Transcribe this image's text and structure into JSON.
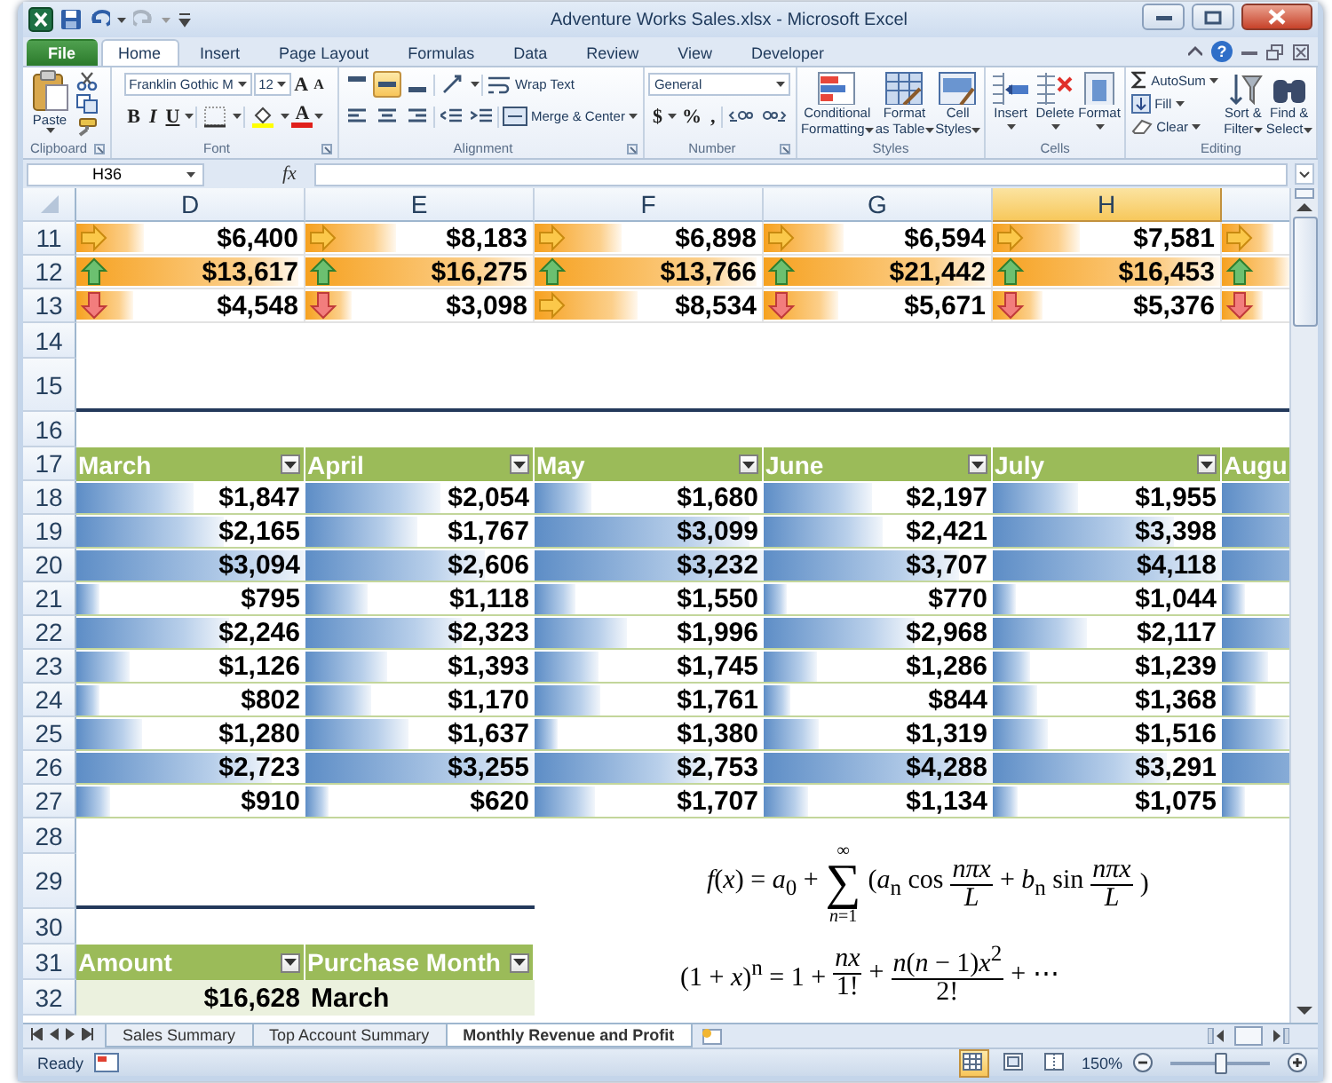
{
  "window": {
    "title": "Adventure Works Sales.xlsx - Microsoft Excel",
    "help": "?"
  },
  "ribbon_tabs": [
    {
      "label": "File",
      "kind": "file",
      "selected": false
    },
    {
      "label": "Home",
      "kind": "tab",
      "selected": true
    },
    {
      "label": "Insert",
      "kind": "tab",
      "selected": false
    },
    {
      "label": "Page Layout",
      "kind": "tab",
      "selected": false
    },
    {
      "label": "Formulas",
      "kind": "tab",
      "selected": false
    },
    {
      "label": "Data",
      "kind": "tab",
      "selected": false
    },
    {
      "label": "Review",
      "kind": "tab",
      "selected": false
    },
    {
      "label": "View",
      "kind": "tab",
      "selected": false
    },
    {
      "label": "Developer",
      "kind": "tab",
      "selected": false
    }
  ],
  "ribbon": {
    "clipboard": {
      "label": "Clipboard",
      "paste": "Paste"
    },
    "font": {
      "label": "Font",
      "name": "Franklin Gothic M",
      "size": "12",
      "grow": "A",
      "shrink": "A",
      "bold": "B",
      "italic": "I",
      "underline": "U",
      "color_letter": "A"
    },
    "alignment": {
      "label": "Alignment",
      "wrap": "Wrap Text",
      "merge": "Merge & Center",
      "vertical": [
        {
          "selected": false
        },
        {
          "selected": true
        },
        {
          "selected": false
        }
      ]
    },
    "number": {
      "label": "Number",
      "format": "General",
      "currency": "$",
      "percent": "%",
      "comma": ","
    },
    "styles": {
      "label": "Styles",
      "buttons": [
        "Conditional\nFormatting",
        "Format\nas Table",
        "Cell\nStyles"
      ]
    },
    "cells": {
      "label": "Cells",
      "buttons": [
        "Insert",
        "Delete",
        "Format"
      ]
    },
    "editing": {
      "label": "Editing",
      "autosum": "AutoSum",
      "fill": "Fill",
      "clear": "Clear",
      "sort": "Sort &\nFilter",
      "find": "Find &\nSelect"
    }
  },
  "formula_bar": {
    "name_box": "H36",
    "function": "fx"
  },
  "columns": [
    {
      "label": "D",
      "selected": false
    },
    {
      "label": "E",
      "selected": false
    },
    {
      "label": "F",
      "selected": false
    },
    {
      "label": "G",
      "selected": false
    },
    {
      "label": "H",
      "selected": true
    }
  ],
  "rows": [
    {
      "number": "11",
      "kind": "icon_bars",
      "cells": [
        {
          "kind": "flat",
          "level": 0.3,
          "value": "$6,400"
        },
        {
          "kind": "flat",
          "level": 0.4,
          "value": "$8,183"
        },
        {
          "kind": "flat",
          "level": 0.38,
          "value": "$6,898"
        },
        {
          "kind": "flat",
          "level": 0.35,
          "value": "$6,594"
        },
        {
          "kind": "flat",
          "level": 0.38,
          "value": "$7,581"
        },
        {
          "kind": "flat",
          "level": 0.23
        }
      ]
    },
    {
      "number": "12",
      "kind": "icon_bars",
      "cells": [
        {
          "kind": "up",
          "level": 0.98,
          "value": "$13,617"
        },
        {
          "kind": "up",
          "level": 1,
          "value": "$16,275"
        },
        {
          "kind": "up",
          "level": 0.98,
          "value": "$13,766"
        },
        {
          "kind": "up",
          "level": 1,
          "value": "$21,442"
        },
        {
          "kind": "up",
          "level": 1,
          "value": "$16,453"
        },
        {
          "kind": "up",
          "level": 0.3
        }
      ]
    },
    {
      "number": "13",
      "kind": "icon_bars",
      "cells": [
        {
          "kind": "down",
          "level": 0.25,
          "value": "$4,548"
        },
        {
          "kind": "down",
          "level": 0.2,
          "value": "$3,098"
        },
        {
          "kind": "flat",
          "level": 0.45,
          "value": "$8,534"
        },
        {
          "kind": "down",
          "level": 0.33,
          "value": "$5,671"
        },
        {
          "kind": "down",
          "level": 0.22,
          "value": "$5,376"
        },
        {
          "kind": "down",
          "level": 0.18
        }
      ]
    },
    {
      "number": "14",
      "kind": "gap"
    },
    {
      "number": "15",
      "kind": "section_end"
    },
    {
      "number": "16",
      "kind": "gap"
    },
    {
      "number": "17",
      "kind": "table_header",
      "cells": [
        "March",
        "April",
        "May",
        "June",
        "July",
        "Augu"
      ]
    },
    {
      "number": "18",
      "kind": "blue_bars",
      "cells": [
        {
          "level": 0.51,
          "value": "$1,847"
        },
        {
          "level": 0.59,
          "value": "$2,054"
        },
        {
          "level": 0.25,
          "value": "$1,680"
        },
        {
          "level": 0.47,
          "value": "$2,197"
        },
        {
          "level": 0.37,
          "value": "$1,955"
        },
        {
          "level": 0.6
        }
      ]
    },
    {
      "number": "19",
      "kind": "blue_bars",
      "cells": [
        {
          "level": 0.64,
          "value": "$2,165"
        },
        {
          "level": 0.49,
          "value": "$1,767"
        },
        {
          "level": 0.94,
          "value": "$3,099"
        },
        {
          "level": 0.52,
          "value": "$2,421"
        },
        {
          "level": 0.79,
          "value": "$3,398"
        },
        {
          "level": 0.7
        }
      ]
    },
    {
      "number": "20",
      "kind": "blue_bars",
      "cells": [
        {
          "level": 1,
          "value": "$3,094"
        },
        {
          "level": 0.78,
          "value": "$2,606"
        },
        {
          "level": 1,
          "value": "$3,232"
        },
        {
          "level": 0.85,
          "value": "$3,707"
        },
        {
          "level": 1,
          "value": "$4,118"
        },
        {
          "level": 0.8
        }
      ]
    },
    {
      "number": "21",
      "kind": "blue_bars",
      "cells": [
        {
          "level": 0.1,
          "value": "$795"
        },
        {
          "level": 0.27,
          "value": "$1,118"
        },
        {
          "level": 0.18,
          "value": "$1,550"
        },
        {
          "level": 0.1,
          "value": "$770"
        },
        {
          "level": 0.1,
          "value": "$1,044"
        },
        {
          "level": 0.1
        }
      ]
    },
    {
      "number": "22",
      "kind": "blue_bars",
      "cells": [
        {
          "level": 0.67,
          "value": "$2,246"
        },
        {
          "level": 0.68,
          "value": "$2,323"
        },
        {
          "level": 0.4,
          "value": "$1,996"
        },
        {
          "level": 0.66,
          "value": "$2,968"
        },
        {
          "level": 0.41,
          "value": "$2,117"
        },
        {
          "level": 0.5
        }
      ]
    },
    {
      "number": "23",
      "kind": "blue_bars",
      "cells": [
        {
          "level": 0.23,
          "value": "$1,126"
        },
        {
          "level": 0.36,
          "value": "$1,393"
        },
        {
          "level": 0.28,
          "value": "$1,745"
        },
        {
          "level": 0.23,
          "value": "$1,286"
        },
        {
          "level": 0.16,
          "value": "$1,239"
        },
        {
          "level": 0.2
        }
      ]
    },
    {
      "number": "24",
      "kind": "blue_bars",
      "cells": [
        {
          "level": 0.1,
          "value": "$802"
        },
        {
          "level": 0.29,
          "value": "$1,170"
        },
        {
          "level": 0.29,
          "value": "$1,761"
        },
        {
          "level": 0.12,
          "value": "$844"
        },
        {
          "level": 0.19,
          "value": "$1,368"
        },
        {
          "level": 0.15
        }
      ]
    },
    {
      "number": "25",
      "kind": "blue_bars",
      "cells": [
        {
          "level": 0.29,
          "value": "$1,280"
        },
        {
          "level": 0.45,
          "value": "$1,637"
        },
        {
          "level": 0.1,
          "value": "$1,380"
        },
        {
          "level": 0.24,
          "value": "$1,319"
        },
        {
          "level": 0.24,
          "value": "$1,516"
        },
        {
          "level": 0.3
        }
      ]
    },
    {
      "number": "26",
      "kind": "blue_bars",
      "cells": [
        {
          "level": 0.85,
          "value": "$2,723"
        },
        {
          "level": 1,
          "value": "$3,255"
        },
        {
          "level": 0.77,
          "value": "$2,753"
        },
        {
          "level": 1,
          "value": "$4,288"
        },
        {
          "level": 0.76,
          "value": "$3,291"
        },
        {
          "level": 0.9
        }
      ]
    },
    {
      "number": "27",
      "kind": "blue_bars",
      "cells": [
        {
          "level": 0.15,
          "value": "$910"
        },
        {
          "level": 0.1,
          "value": "$620"
        },
        {
          "level": 0.26,
          "value": "$1,707"
        },
        {
          "level": 0.19,
          "value": "$1,134"
        },
        {
          "level": 0.11,
          "value": "$1,075"
        },
        {
          "level": 0.1
        }
      ]
    },
    {
      "number": "28",
      "kind": "gap"
    },
    {
      "number": "29",
      "kind": "formula_row"
    },
    {
      "number": "30",
      "kind": "gap"
    },
    {
      "number": "31",
      "kind": "table_header2",
      "cells": [
        "Amount",
        "Purchase Month"
      ]
    },
    {
      "number": "32",
      "kind": "table_row2",
      "cells": [
        "$16,628",
        "March"
      ]
    }
  ],
  "equations": [
    {
      "tokens": [
        {
          "kind": "text",
          "text": "*f*(*x*) = *a*$_{0}$ +"
        },
        {
          "kind": "sum",
          "sign": "∑",
          "top": "∞",
          "bottom": "*n*=1"
        },
        {
          "kind": "text",
          "text": "(*a*$_{n}$ cos"
        },
        {
          "kind": "frac",
          "num": "*nπx*",
          "den": "*L*"
        },
        {
          "kind": "text",
          "text": "+ *b*$_{n}$ sin"
        },
        {
          "kind": "frac",
          "num": "*nπx*",
          "den": "*L*"
        },
        {
          "kind": "text",
          "text": ")"
        }
      ]
    },
    {
      "tokens": [
        {
          "kind": "text",
          "text": "(1 + *x*)$^{n}$ = 1 +"
        },
        {
          "kind": "frac",
          "num": "*nx*",
          "den": "1!"
        },
        {
          "kind": "text",
          "text": "+"
        },
        {
          "kind": "frac",
          "num": "*n*(*n* − 1)*x*$^{2}$",
          "den": "2!"
        },
        {
          "kind": "text",
          "text": "+ ⋯"
        }
      ]
    }
  ],
  "sheet_tabs": [
    {
      "label": "Sales Summary",
      "selected": false
    },
    {
      "label": "Top Account Summary",
      "selected": false
    },
    {
      "label": "Monthly Revenue and Profit",
      "selected": true
    }
  ],
  "status": {
    "ready": "Ready",
    "views": [
      {
        "selected": true
      },
      {
        "selected": false
      },
      {
        "selected": false
      }
    ],
    "zoom": "150%",
    "zoom_slider": {
      "level": 0.5
    }
  }
}
